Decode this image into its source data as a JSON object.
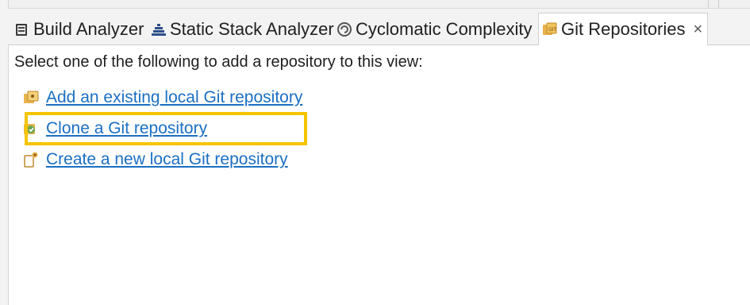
{
  "tabs": [
    {
      "label": "Build Analyzer",
      "icon": "build-analyzer-icon",
      "active": false
    },
    {
      "label": "Static Stack Analyzer",
      "icon": "stack-analyzer-icon",
      "active": false
    },
    {
      "label": "Cyclomatic Complexity",
      "icon": "cyclomatic-icon",
      "active": false
    },
    {
      "label": "Git Repositories",
      "icon": "git-repositories-icon",
      "active": true,
      "close_label": "×"
    }
  ],
  "view": {
    "prompt": "Select one of the following to add a repository to this view:",
    "actions": [
      {
        "label": "Add an existing local Git repository",
        "icon": "add-existing-repo-icon"
      },
      {
        "label": "Clone a Git repository",
        "icon": "clone-repo-icon",
        "highlighted": true
      },
      {
        "label": "Create a new local Git repository",
        "icon": "create-repo-icon"
      }
    ]
  },
  "colors": {
    "link": "#1a6fc4",
    "highlight": "#f5c400"
  }
}
